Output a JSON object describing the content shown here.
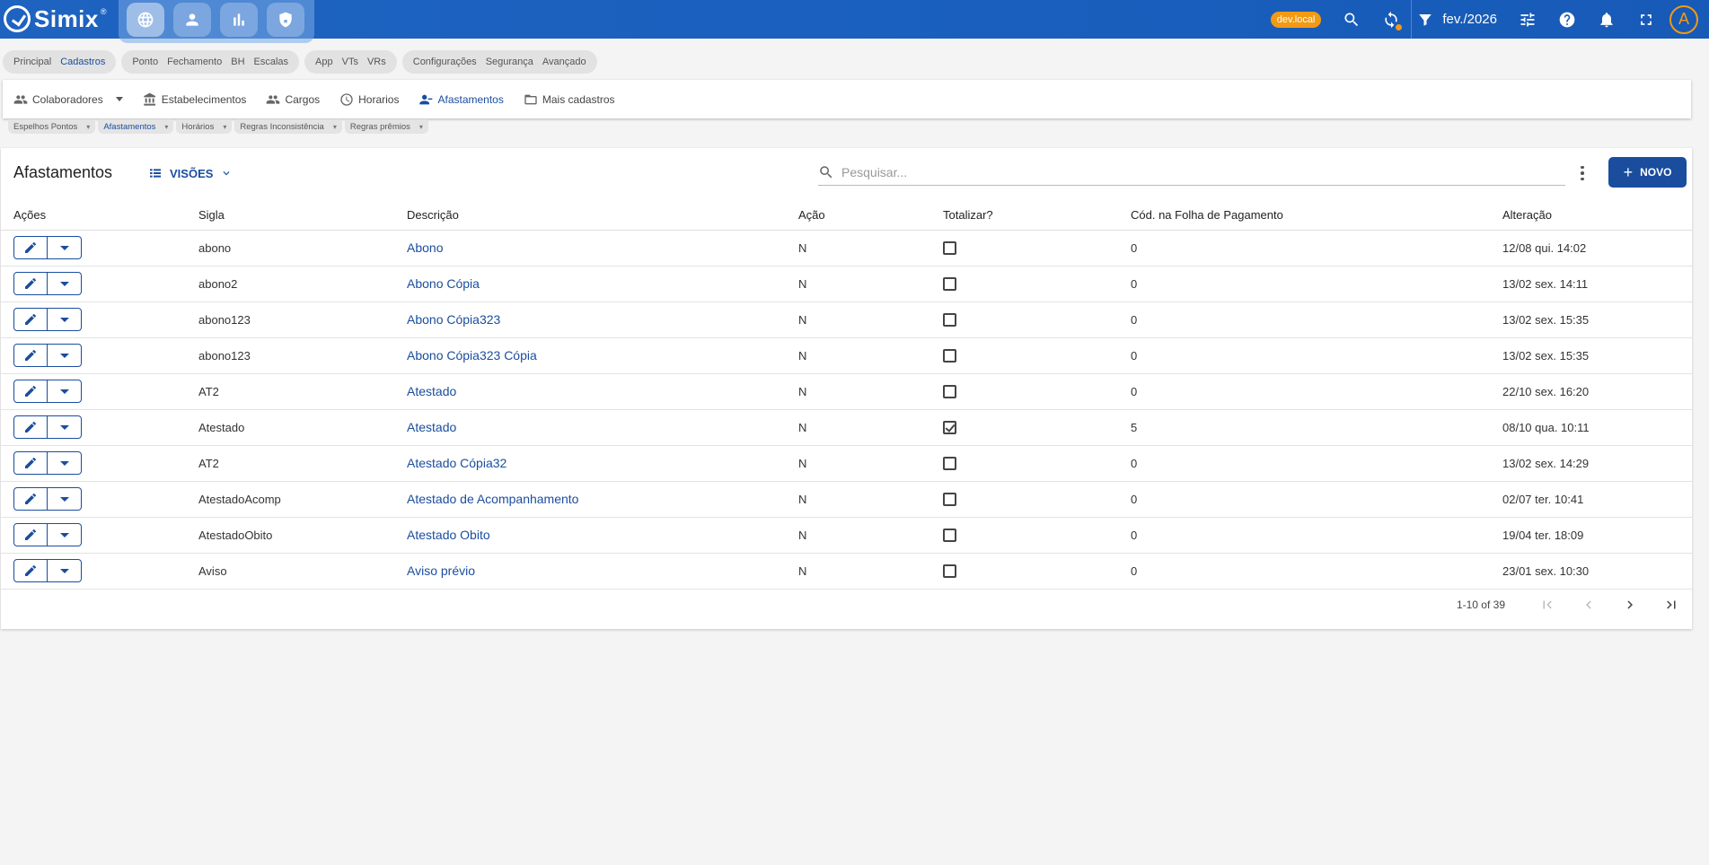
{
  "app": {
    "name": "Simix",
    "reg_mark": "®"
  },
  "topbar": {
    "env_badge": "dev.local",
    "period": "fev./2026",
    "avatar_letter": "A"
  },
  "module_groups": [
    {
      "items": [
        "Principal",
        "Cadastros"
      ],
      "selected": "Cadastros"
    },
    {
      "items": [
        "Ponto",
        "Fechamento",
        "BH",
        "Escalas"
      ]
    },
    {
      "items": [
        "App",
        "VTs",
        "VRs"
      ]
    },
    {
      "items": [
        "Configurações",
        "Segurança",
        "Avançado"
      ]
    }
  ],
  "nav": {
    "colaboradores": "Colaboradores",
    "estabelecimentos": "Estabelecimentos",
    "cargos": "Cargos",
    "horarios": "Horarios",
    "afastamentos": "Afastamentos",
    "mais": "Mais cadastros"
  },
  "subtabs": {
    "espelhos": "Espelhos Pontos",
    "afastamentos": "Afastamentos",
    "horarios": "Horários",
    "regras_inconsistencia": "Regras Inconsistência",
    "regras_premios": "Regras prêmios"
  },
  "page": {
    "title": "Afastamentos",
    "views_label": "VISÕES",
    "search_placeholder": "Pesquisar...",
    "new_label": "NOVO"
  },
  "table": {
    "headers": {
      "acoes": "Ações",
      "sigla": "Sigla",
      "descricao": "Descrição",
      "acao": "Ação",
      "totalizar": "Totalizar?",
      "cod_folha": "Cód. na Folha de Pagamento",
      "alteracao": "Alteração"
    },
    "rows": [
      {
        "sigla": "abono",
        "descricao": "Abono",
        "acao": "N",
        "totalizar": false,
        "cod": "0",
        "alteracao": "12/08 qui. 14:02"
      },
      {
        "sigla": "abono2",
        "descricao": "Abono Cópia",
        "acao": "N",
        "totalizar": false,
        "cod": "0",
        "alteracao": "13/02 sex. 14:11"
      },
      {
        "sigla": "abono123",
        "descricao": "Abono Cópia323",
        "acao": "N",
        "totalizar": false,
        "cod": "0",
        "alteracao": "13/02 sex. 15:35"
      },
      {
        "sigla": "abono123",
        "descricao": "Abono Cópia323 Cópia",
        "acao": "N",
        "totalizar": false,
        "cod": "0",
        "alteracao": "13/02 sex. 15:35"
      },
      {
        "sigla": "AT2",
        "descricao": "Atestado",
        "acao": "N",
        "totalizar": false,
        "cod": "0",
        "alteracao": "22/10 sex. 16:20"
      },
      {
        "sigla": "Atestado",
        "descricao": "Atestado",
        "acao": "N",
        "totalizar": true,
        "cod": "5",
        "alteracao": "08/10 qua. 10:11"
      },
      {
        "sigla": "AT2",
        "descricao": "Atestado Cópia32",
        "acao": "N",
        "totalizar": false,
        "cod": "0",
        "alteracao": "13/02 sex. 14:29"
      },
      {
        "sigla": "AtestadoAcomp",
        "descricao": "Atestado de Acompanhamento",
        "acao": "N",
        "totalizar": false,
        "cod": "0",
        "alteracao": "02/07 ter. 10:41"
      },
      {
        "sigla": "AtestadoObito",
        "descricao": "Atestado Obito",
        "acao": "N",
        "totalizar": false,
        "cod": "0",
        "alteracao": "19/04 ter. 18:09"
      },
      {
        "sigla": "Aviso",
        "descricao": "Aviso prévio",
        "acao": "N",
        "totalizar": false,
        "cod": "0",
        "alteracao": "23/01 sex. 10:30"
      }
    ]
  },
  "pagination": {
    "range": "1-10 of 39"
  }
}
